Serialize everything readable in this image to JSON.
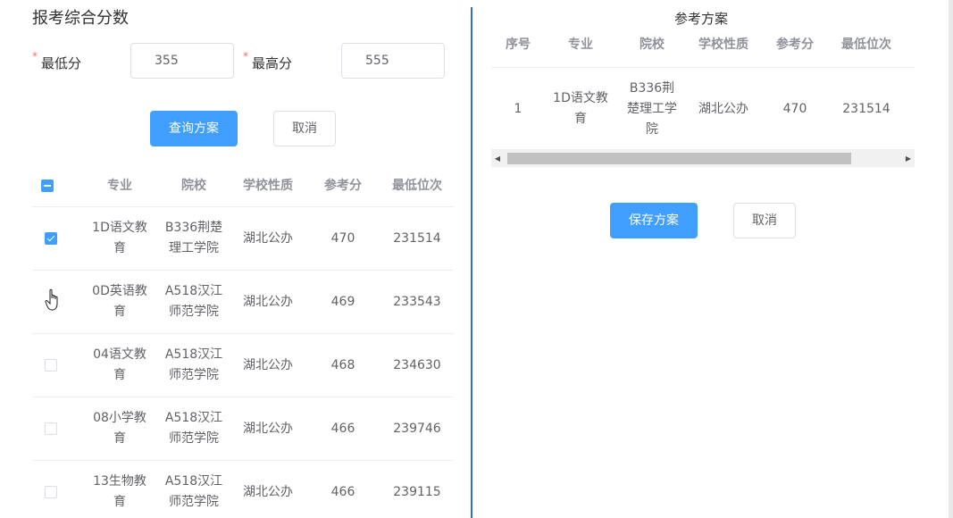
{
  "left": {
    "title": "报考综合分数",
    "required_mark": "*",
    "min_score_label": "最低分",
    "min_score_value": "355",
    "max_score_label": "最高分",
    "max_score_value": "555",
    "query_button": "查询方案",
    "cancel_button": "取消",
    "columns": [
      "专业",
      "院校",
      "学校性质",
      "参考分",
      "最低位次"
    ],
    "rows": [
      {
        "checked": true,
        "major_l1": "1D语文教",
        "major_l2": "育",
        "school_l1": "B336荆楚",
        "school_l2": "理工学院",
        "type": "湖北公办",
        "score": "470",
        "rank": "231514"
      },
      {
        "checked": false,
        "major_l1": "0D英语教",
        "major_l2": "育",
        "school_l1": "A518汉江",
        "school_l2": "师范学院",
        "type": "湖北公办",
        "score": "469",
        "rank": "233543"
      },
      {
        "checked": false,
        "major_l1": "04语文教",
        "major_l2": "育",
        "school_l1": "A518汉江",
        "school_l2": "师范学院",
        "type": "湖北公办",
        "score": "468",
        "rank": "234630"
      },
      {
        "checked": false,
        "major_l1": "08小学教",
        "major_l2": "育",
        "school_l1": "A518汉江",
        "school_l2": "师范学院",
        "type": "湖北公办",
        "score": "466",
        "rank": "239746"
      },
      {
        "checked": false,
        "major_l1": "13生物教",
        "major_l2": "育",
        "school_l1": "A518汉江",
        "school_l2": "师范学院",
        "type": "湖北公办",
        "score": "466",
        "rank": "239115"
      }
    ]
  },
  "right": {
    "title": "参考方案",
    "columns": [
      "序号",
      "专业",
      "院校",
      "学校性质",
      "参考分",
      "最低位次"
    ],
    "row": {
      "index": "1",
      "major_l1": "1D语文教",
      "major_l2": "育",
      "school_l1": "B336荆",
      "school_l2": "楚理工学",
      "school_l3": "院",
      "type": "湖北公办",
      "score": "470",
      "rank": "231514"
    },
    "save_button": "保存方案",
    "cancel_button": "取消"
  },
  "colors": {
    "primary": "#409eff",
    "divider": "#3370d6",
    "required": "#f56c6c"
  }
}
